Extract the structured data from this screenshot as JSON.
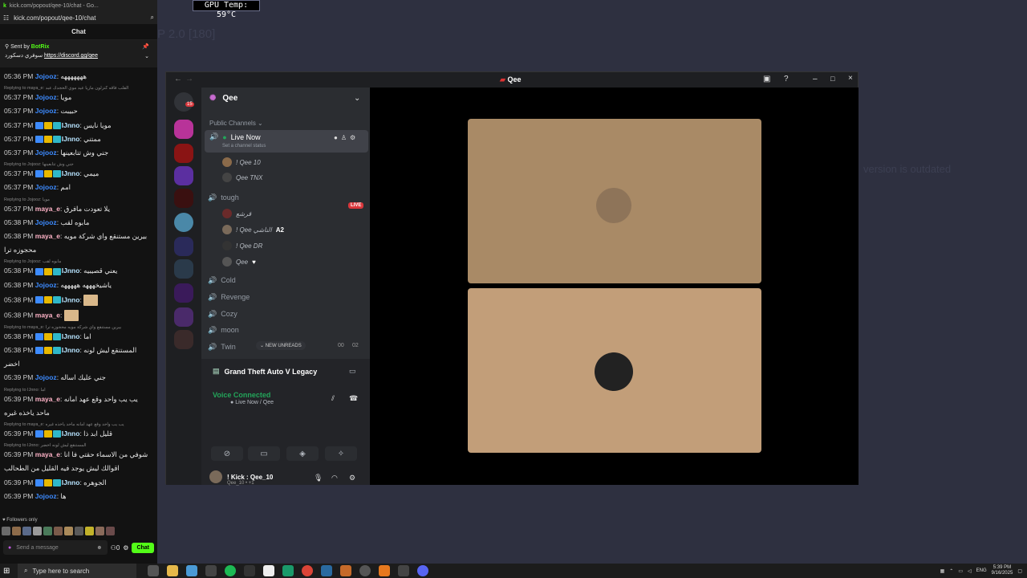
{
  "overlay": {
    "gpu_temp": "GPU Temp: 59°C"
  },
  "background_app": {
    "ghost_title": "P 2.0 [180]",
    "ghost_version": "version is outdated"
  },
  "chat_popout": {
    "window_title": "kick.com/popout/qee-10/chat - Go...",
    "url": "kick.com/popout/qee-10/chat",
    "header": "Chat",
    "pinned": {
      "sent_by_label": "Sent by",
      "sender": "BotRix",
      "text": "سوفري دسكورد",
      "link": "https://discord.gg/qee"
    },
    "messages": [
      {
        "time": "05:36 PM",
        "user": "Jojooz",
        "text": "هههههههه",
        "color": "#3d8bff"
      },
      {
        "reply": "Replying to maya_e: القلب فاقه كنزلون ماريا عيد موي الحجدك عبد"
      },
      {
        "time": "05:37 PM",
        "user": "Jojooz",
        "text": "مويا",
        "color": "#3d8bff"
      },
      {
        "time": "05:37 PM",
        "user": "Jojooz",
        "text": "حبيبت",
        "color": "#3d8bff"
      },
      {
        "time": "05:37 PM",
        "user": "IJnno",
        "text": "مويا نايس",
        "color": "#b8e4ff",
        "badges": true
      },
      {
        "time": "05:37 PM",
        "user": "IJnno",
        "text": "ممتني",
        "color": "#b8e4ff",
        "badges": true
      },
      {
        "time": "05:37 PM",
        "user": "Jojooz",
        "text": "جني وش تتابعينها",
        "color": "#3d8bff"
      },
      {
        "reply": "Replying to Jojooz: جني وش تتابعينها"
      },
      {
        "time": "05:37 PM",
        "user": "IJnno",
        "text": "ميمي",
        "color": "#b8e4ff",
        "badges": true
      },
      {
        "time": "05:37 PM",
        "user": "Jojooz",
        "text": "امم",
        "color": "#3d8bff"
      },
      {
        "reply": "Replying to Jojooz: مويا"
      },
      {
        "time": "05:37 PM",
        "user": "maya_e",
        "text": "يلا تعودت مافرق",
        "color": "#ffb3c7"
      },
      {
        "time": "05:38 PM",
        "user": "Jojooz",
        "text": "مابوه لقب",
        "color": "#3d8bff"
      },
      {
        "time": "05:38 PM",
        "user": "maya_e",
        "text": "بيرين مستنقع واي شركة مويه",
        "color": "#ffb3c7"
      },
      {
        "cont": "محجوزه ترا"
      },
      {
        "reply": "Replying to Jojooz: مابوه لقب"
      },
      {
        "time": "05:38 PM",
        "user": "IJnno",
        "text": "يعني قصيبيه",
        "color": "#b8e4ff",
        "badges": true
      },
      {
        "time": "05:38 PM",
        "user": "Jojooz",
        "text": "ياشيخهههه هههههه",
        "color": "#3d8bff"
      },
      {
        "time": "05:38 PM",
        "user": "IJnno",
        "text": "",
        "color": "#b8e4ff",
        "badges": true,
        "emote": true
      },
      {
        "time": "05:38 PM",
        "user": "maya_e",
        "text": "",
        "color": "#ffb3c7",
        "emote": true
      },
      {
        "reply": "Replying to maya_e: بيرين مستنقع واي شركة مويه محجوزه ترا"
      },
      {
        "time": "05:38 PM",
        "user": "IJnno",
        "text": "اما",
        "color": "#b8e4ff",
        "badges": true
      },
      {
        "time": "05:38 PM",
        "user": "IJnno",
        "text": "المستنقع ليش لونه",
        "color": "#b8e4ff",
        "badges": true
      },
      {
        "cont": "اخضر"
      },
      {
        "time": "05:39 PM",
        "user": "Jojooz",
        "text": "جني عليك اساله",
        "color": "#3d8bff"
      },
      {
        "reply": "Replying to IJnno: اما"
      },
      {
        "time": "05:39 PM",
        "user": "maya_e",
        "text": "يب يب واحد وقع عهد امانه",
        "color": "#ffb3c7"
      },
      {
        "cont": "ماحد ياخذه غيره"
      },
      {
        "reply": "Replying to maya_e: يب يب واحد وقع عهد امانه ماحد ياخذه غيره"
      },
      {
        "time": "05:39 PM",
        "user": "IJnno",
        "text": "قليل ابد ذا",
        "color": "#b8e4ff",
        "badges": true
      },
      {
        "reply": "Replying to IJnno: المستنقع ليش لونه اخضر"
      },
      {
        "time": "05:39 PM",
        "user": "maya_e",
        "text": "شوفي من الاسماء حقتي فا انا",
        "color": "#ffb3c7"
      },
      {
        "cont": "اقوالك ليش يوجد فيه القليل من الطحالب"
      },
      {
        "time": "05:39 PM",
        "user": "IJnno",
        "text": "الجوهره",
        "color": "#b8e4ff",
        "badges": true
      },
      {
        "time": "05:39 PM",
        "user": "Jojooz",
        "text": "ها",
        "color": "#3d8bff"
      }
    ],
    "followers_only": "Followers only",
    "input_placeholder": "Send a message",
    "send_label": "Chat",
    "viewer_count": "0"
  },
  "discord": {
    "title": "Qee",
    "server_name": "Qee",
    "unread_badge": "15",
    "section_label": "Public Channels",
    "live_channel": {
      "name": "Live Now",
      "status": "Set a channel status"
    },
    "live_members": [
      "! Qee 10",
      "Qee TNX"
    ],
    "channels": [
      {
        "name": "tough",
        "live": true
      },
      {
        "name": "Cold"
      },
      {
        "name": "Revenge"
      },
      {
        "name": "Cozy"
      },
      {
        "name": "moon"
      },
      {
        "name": "Twin"
      }
    ],
    "live_badge": "LIVE",
    "tough_members": [
      "قرشع",
      "! Qee الناشي",
      "! Qee DR",
      "Qee"
    ],
    "a2_tag": "A2",
    "new_unreads": "NEW UNREADS",
    "twin_counts": [
      "00",
      "02"
    ],
    "activity": "Grand Theft Auto V Legacy",
    "voice_status": "Voice Connected",
    "voice_location": "Live Now / Qee",
    "user": {
      "name": "! Kick : Qee_10",
      "sub": "Qee_10 • +1"
    }
  },
  "taskbar": {
    "search_placeholder": "Type here to search",
    "lang": "ENG",
    "time": "5:39 PM",
    "date": "9/16/2025"
  }
}
